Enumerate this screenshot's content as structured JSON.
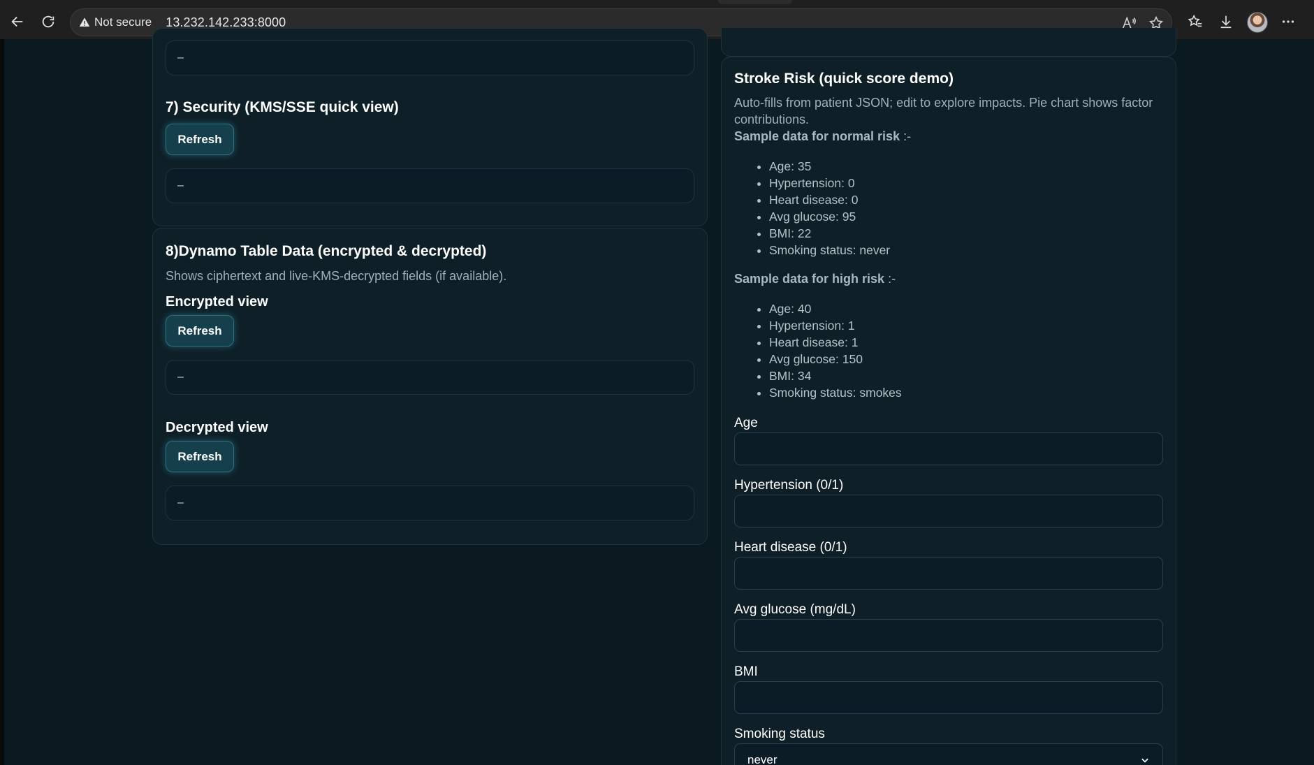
{
  "browser": {
    "security_label": "Not secure",
    "url": "13.232.142.233:8000"
  },
  "left": {
    "top_output": "–",
    "security": {
      "title": "7) Security (KMS/SSE quick view)",
      "refresh_label": "Refresh",
      "output": "–"
    },
    "dynamo": {
      "title": "8)Dynamo Table Data (encrypted & decrypted)",
      "subtitle": "Shows ciphertext and live-KMS-decrypted fields (if available).",
      "encrypted": {
        "title": "Encrypted view",
        "refresh_label": "Refresh",
        "output": "–"
      },
      "decrypted": {
        "title": "Decrypted view",
        "refresh_label": "Refresh",
        "output": "–"
      }
    }
  },
  "stroke": {
    "title": "Stroke Risk (quick score demo)",
    "description_line1": "Auto-fills from patient JSON; edit to explore impacts. Pie chart shows factor",
    "description_line2": "contributions.",
    "normal": {
      "title": "Sample data for normal risk",
      "title_tail": " :-",
      "items": [
        "Age: 35",
        "Hypertension: 0",
        "Heart disease: 0",
        "Avg glucose: 95",
        "BMI: 22",
        "Smoking status: never"
      ]
    },
    "high": {
      "title": "Sample data for high risk",
      "title_tail": " :-",
      "items": [
        "Age: 40",
        "Hypertension: 1",
        "Heart disease: 1",
        "Avg glucose: 150",
        "BMI: 34",
        "Smoking status: smokes"
      ]
    },
    "fields": {
      "age_label": "Age",
      "hypertension_label": "Hypertension (0/1)",
      "heart_label": "Heart disease (0/1)",
      "glucose_label": "Avg glucose (mg/dL)",
      "bmi_label": "BMI",
      "smoking_label": "Smoking status",
      "smoking_value": "never"
    }
  }
}
